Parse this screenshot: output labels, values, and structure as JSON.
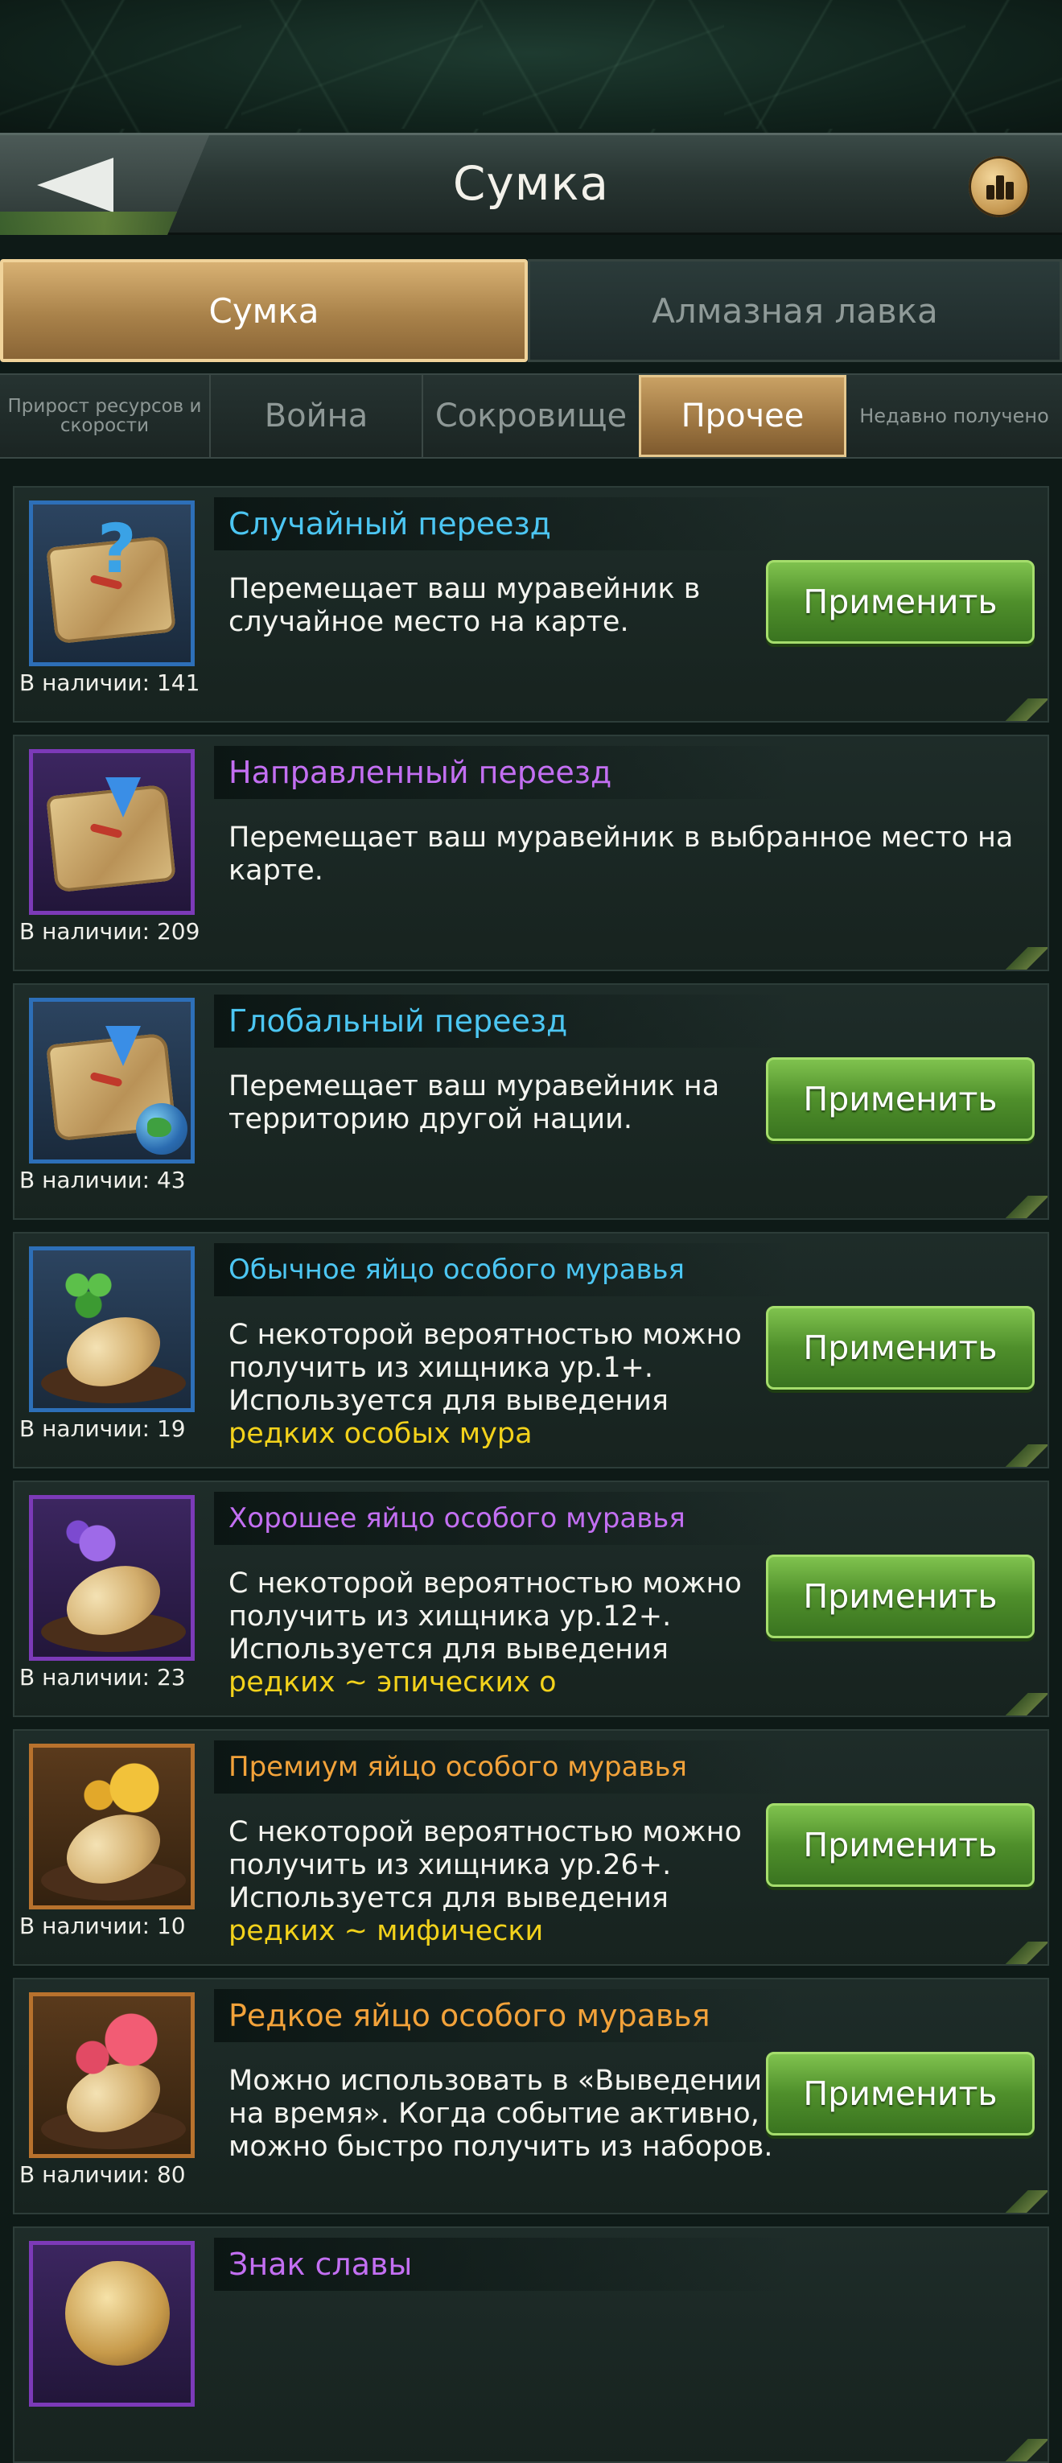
{
  "header": {
    "title": "Сумка",
    "back_icon": "back-arrow-icon",
    "stats_icon": "bar-chart-icon"
  },
  "main_tabs": [
    {
      "label": "Сумка",
      "active": true
    },
    {
      "label": "Алмазная лавка",
      "active": false
    }
  ],
  "sub_tabs": [
    {
      "label": "Прирост ресурсов и скорости"
    },
    {
      "label": "Война"
    },
    {
      "label": "Сокровище"
    },
    {
      "label": "Прочее"
    },
    {
      "label": "Недавно получено"
    }
  ],
  "colors": {
    "accent_gold": "#c9a164",
    "button_green": "#4f8f2b",
    "title_blue": "#4cc6f2",
    "title_purple": "#c36ff2",
    "title_orange": "#f2a23a",
    "highlight_yellow": "#f3d21b"
  },
  "items": [
    {
      "title": "Случайный переезд",
      "count": "В наличии: 141",
      "desc": "Перемещает ваш муравейник в случайное место на карте.",
      "button": "Применить",
      "icon": "random-relocation-map-icon"
    },
    {
      "title": "Направленный переезд",
      "count": "В наличии: 209",
      "desc": "Перемещает ваш муравейник в выбранное место на карте.",
      "icon": "targeted-relocation-map-icon"
    },
    {
      "title": "Глобальный переезд",
      "count": "В наличии: 43",
      "desc": "Перемещает ваш муравейник на территорию другой нации.",
      "button": "Применить",
      "icon": "global-relocation-map-icon"
    },
    {
      "title": "Обычное яйцо особого муравья",
      "count": "В наличии: 19",
      "desc": "С некоторой вероятностью можно получить из хищника ур.1+. Используется для выведения ",
      "desc_highlight": "редких особых мура",
      "button": "Применить",
      "icon": "common-egg-icon"
    },
    {
      "title": "Хорошее яйцо особого муравья",
      "count": "В наличии: 23",
      "desc": "С некоторой вероятностью можно получить из хищника ур.12+. Используется для выведения ",
      "desc_highlight": "редких ~ эпических о",
      "button": "Применить",
      "icon": "good-egg-icon"
    },
    {
      "title": "Премиум яйцо особого муравья",
      "count": "В наличии: 10",
      "desc": "С некоторой вероятностью можно получить из хищника ур.26+. Используется для выведения ",
      "desc_highlight": "редких ~ мифически",
      "button": "Применить",
      "icon": "premium-egg-icon"
    },
    {
      "title": "Редкое яйцо особого муравья",
      "count": "В наличии: 80",
      "desc": "Можно использовать в «Выведении на время». Когда событие активно, можно быстро получить из наборов.",
      "button": "Применить",
      "icon": "rare-egg-icon"
    },
    {
      "title": "Знак славы",
      "icon": "glory-badge-icon"
    }
  ]
}
